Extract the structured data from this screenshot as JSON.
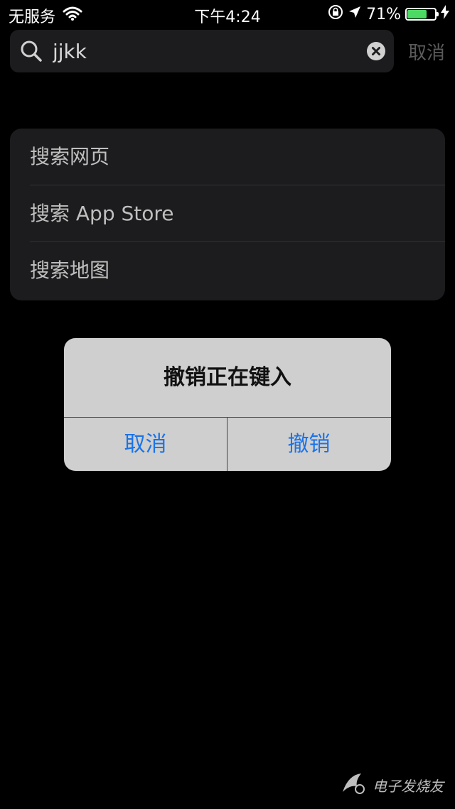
{
  "status_bar": {
    "carrier": "无服务",
    "time": "下午4:24",
    "battery_percent": "71%",
    "battery_level": 0.71,
    "battery_color": "#4cd964",
    "icons": [
      "wifi-icon",
      "orientation-lock-icon",
      "location-arrow-icon",
      "battery-icon",
      "charging-bolt-icon"
    ]
  },
  "search": {
    "value": "jjkk",
    "cancel_label": "取消",
    "icons": [
      "search-icon",
      "clear-icon"
    ]
  },
  "suggestions": [
    {
      "label": "搜索网页"
    },
    {
      "label": "搜索 App Store"
    },
    {
      "label": "搜索地图"
    }
  ],
  "alert": {
    "title": "撤销正在键入",
    "cancel_label": "取消",
    "undo_label": "撤销",
    "button_color": "#1a73e8"
  },
  "watermark": {
    "text": "电子发烧友",
    "icon": "watermark-logo-icon"
  }
}
